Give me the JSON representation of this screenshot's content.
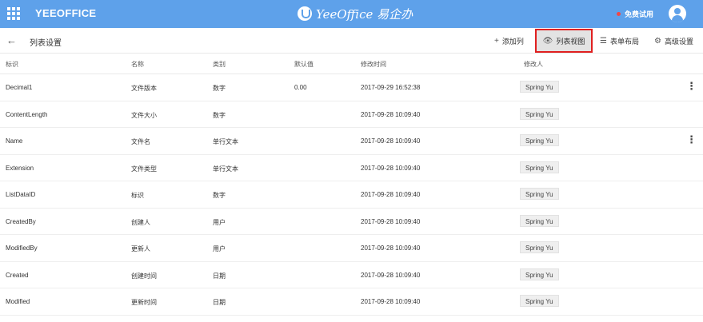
{
  "header": {
    "brand": "YEEOFFICE",
    "center_title": "YeeOffice 易企办",
    "trial_label": "免费试用",
    "colors": {
      "topbar": "#5ea1ea",
      "trial_dot": "#f04848",
      "highlight_border": "#e02020"
    }
  },
  "toolbar": {
    "back_icon": "←",
    "title": "列表设置",
    "add_column": "添加列",
    "add_icon": "+",
    "list_view": "列表视图",
    "view_icon": "👁",
    "form_layout": "表单布局",
    "form_icon": "☰",
    "advanced": "高级设置",
    "advanced_icon": "⚙"
  },
  "table": {
    "columns": [
      "标识",
      "名称",
      "类别",
      "默认值",
      "修改时间",
      "修改人"
    ],
    "rows": [
      {
        "id": "Decimal1",
        "name": "文件版本",
        "type": "数字",
        "default": "0.00",
        "modified": "2017-09-29 16:52:38",
        "by": "Spring Yu",
        "more": true
      },
      {
        "id": "ContentLength",
        "name": "文件大小",
        "type": "数字",
        "default": "",
        "modified": "2017-09-28 10:09:40",
        "by": "Spring Yu",
        "more": false
      },
      {
        "id": "Name",
        "name": "文件名",
        "type": "单行文本",
        "default": "",
        "modified": "2017-09-28 10:09:40",
        "by": "Spring Yu",
        "more": true
      },
      {
        "id": "Extension",
        "name": "文件类型",
        "type": "单行文本",
        "default": "",
        "modified": "2017-09-28 10:09:40",
        "by": "Spring Yu",
        "more": false
      },
      {
        "id": "ListDataID",
        "name": "标识",
        "type": "数字",
        "default": "",
        "modified": "2017-09-28 10:09:40",
        "by": "Spring Yu",
        "more": false
      },
      {
        "id": "CreatedBy",
        "name": "创建人",
        "type": "用户",
        "default": "",
        "modified": "2017-09-28 10:09:40",
        "by": "Spring Yu",
        "more": false
      },
      {
        "id": "ModifiedBy",
        "name": "更新人",
        "type": "用户",
        "default": "",
        "modified": "2017-09-28 10:09:40",
        "by": "Spring Yu",
        "more": false
      },
      {
        "id": "Created",
        "name": "创建时间",
        "type": "日期",
        "default": "",
        "modified": "2017-09-28 10:09:40",
        "by": "Spring Yu",
        "more": false
      },
      {
        "id": "Modified",
        "name": "更新时间",
        "type": "日期",
        "default": "",
        "modified": "2017-09-28 10:09:40",
        "by": "Spring Yu",
        "more": false
      }
    ]
  }
}
